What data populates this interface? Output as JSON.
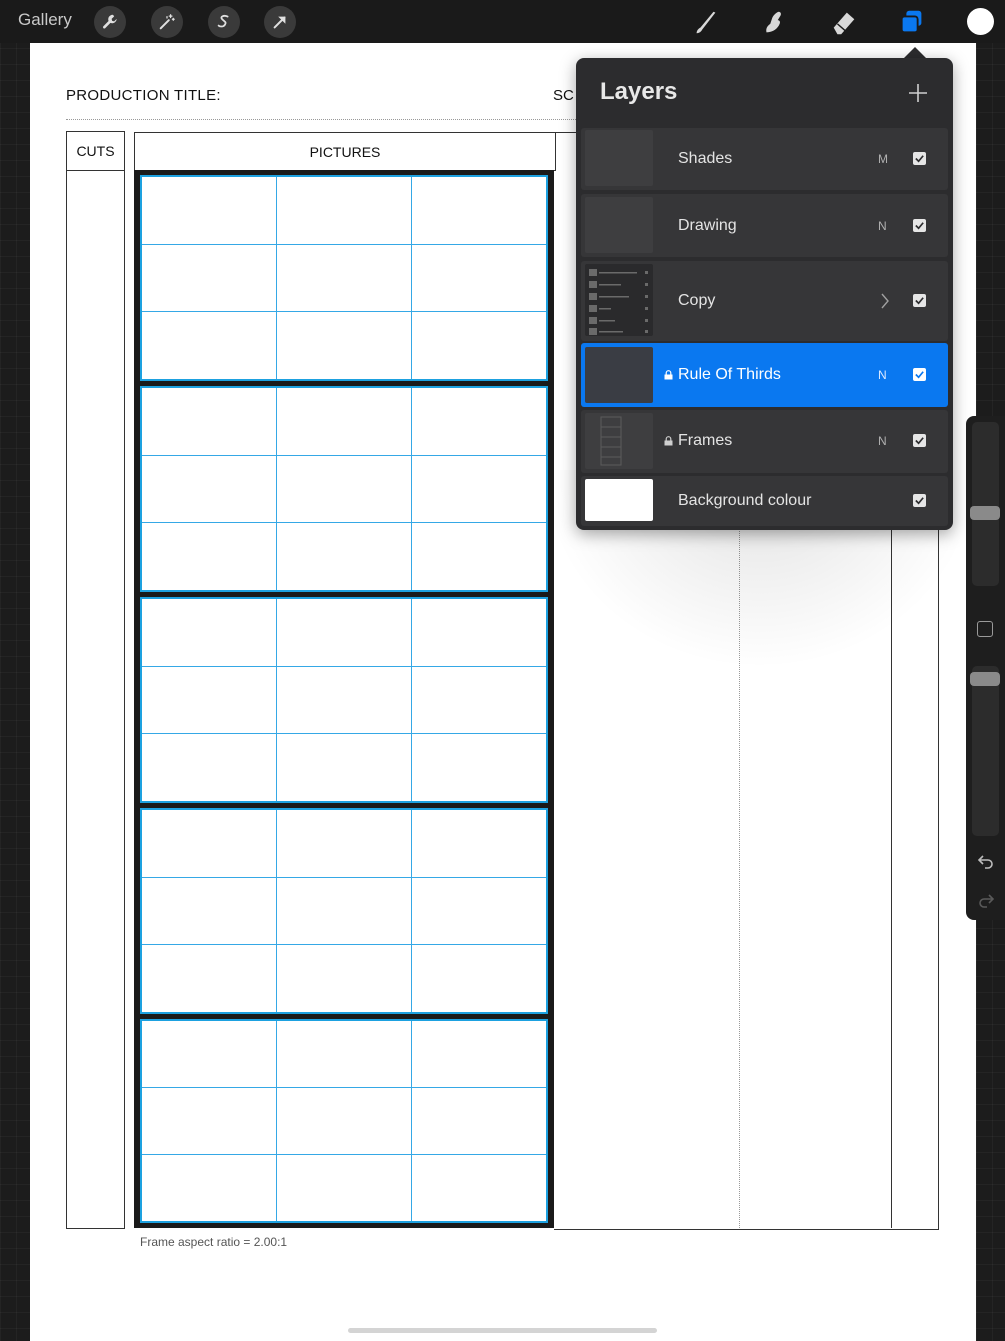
{
  "toolbar": {
    "gallery_label": "Gallery",
    "left_buttons": [
      "wrench-icon",
      "magic-wand-icon",
      "selection-s-icon",
      "transform-arrow-icon"
    ],
    "right_tools": [
      "brush-icon",
      "smudge-icon",
      "eraser-icon",
      "layers-icon"
    ],
    "active_tool": "layers-icon",
    "accent_color": "#0a78f0",
    "current_color": "#ffffff"
  },
  "canvas": {
    "production_title_label": "PRODUCTION TITLE:",
    "scene_label_partial": "SC",
    "cuts_header": "CUTS",
    "pictures_header": "PICTURES",
    "frame_count": 5,
    "aspect_note": "Frame aspect ratio = 2.00:1"
  },
  "layers_panel": {
    "title": "Layers",
    "add_button": "+",
    "layers": [
      {
        "name": "Shades",
        "blend": "M",
        "visible": true,
        "locked": false,
        "active": false,
        "group": false
      },
      {
        "name": "Drawing",
        "blend": "N",
        "visible": true,
        "locked": false,
        "active": false,
        "group": false
      },
      {
        "name": "Copy",
        "blend": "",
        "visible": true,
        "locked": false,
        "active": false,
        "group": true
      },
      {
        "name": "Rule Of Thirds",
        "blend": "N",
        "visible": true,
        "locked": true,
        "active": true,
        "group": false
      },
      {
        "name": "Frames",
        "blend": "N",
        "visible": true,
        "locked": true,
        "active": false,
        "group": false
      },
      {
        "name": "Background colour",
        "blend": "",
        "visible": true,
        "locked": false,
        "active": false,
        "group": false
      }
    ]
  },
  "sidebar": {
    "brush_size_level": 0.55,
    "opacity_level": 0.95,
    "undo_icon": "undo-icon",
    "redo_icon": "redo-icon"
  }
}
